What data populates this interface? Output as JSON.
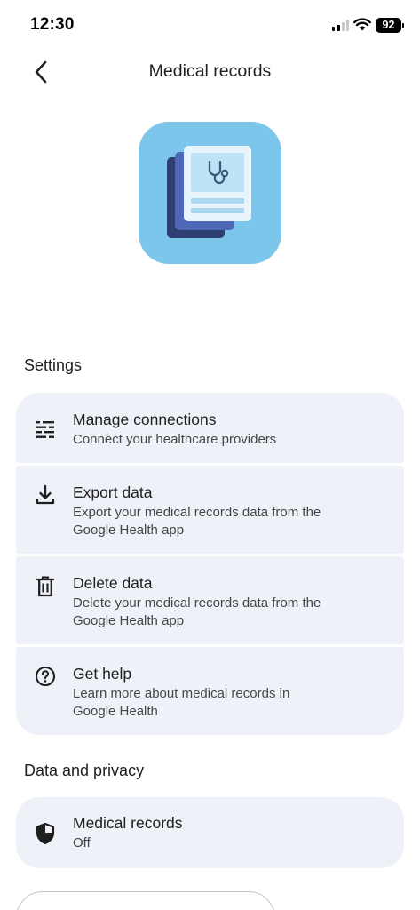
{
  "status_bar": {
    "time": "12:30",
    "battery": "92",
    "signal_bars": 2,
    "icons": [
      "cellular-signal-icon",
      "wifi-icon",
      "battery-icon"
    ]
  },
  "app_bar": {
    "title": "Medical records",
    "back_icon": "chevron-left-icon"
  },
  "hero": {
    "icon": "medical-records-document-stethoscope-icon",
    "background_color": "#7cc6ec"
  },
  "settings": {
    "header": "Settings",
    "items": [
      {
        "icon": "connections-icon",
        "title": "Manage connections",
        "subtitle_lines": [
          "Connect your healthcare providers"
        ]
      },
      {
        "icon": "download-icon",
        "title": "Export data",
        "subtitle_lines": [
          "Export your medical records data from the",
          "Google Health app"
        ]
      },
      {
        "icon": "trash-icon",
        "title": "Delete data",
        "subtitle_lines": [
          "Delete your medical records data from the",
          "Google Health app"
        ]
      },
      {
        "icon": "help-circle-icon",
        "title": "Get help",
        "subtitle_lines": [
          "Learn more about medical records in",
          "Google Health"
        ]
      }
    ]
  },
  "privacy": {
    "header": "Data and privacy",
    "items": [
      {
        "icon": "shield-icon",
        "title": "Medical records",
        "subtitle_lines": [
          "Off"
        ]
      }
    ]
  },
  "colors": {
    "card_background": "#eef1f7",
    "text_primary": "#1f1f1f",
    "text_secondary": "#444746",
    "hero_background": "#7cc6ec"
  }
}
